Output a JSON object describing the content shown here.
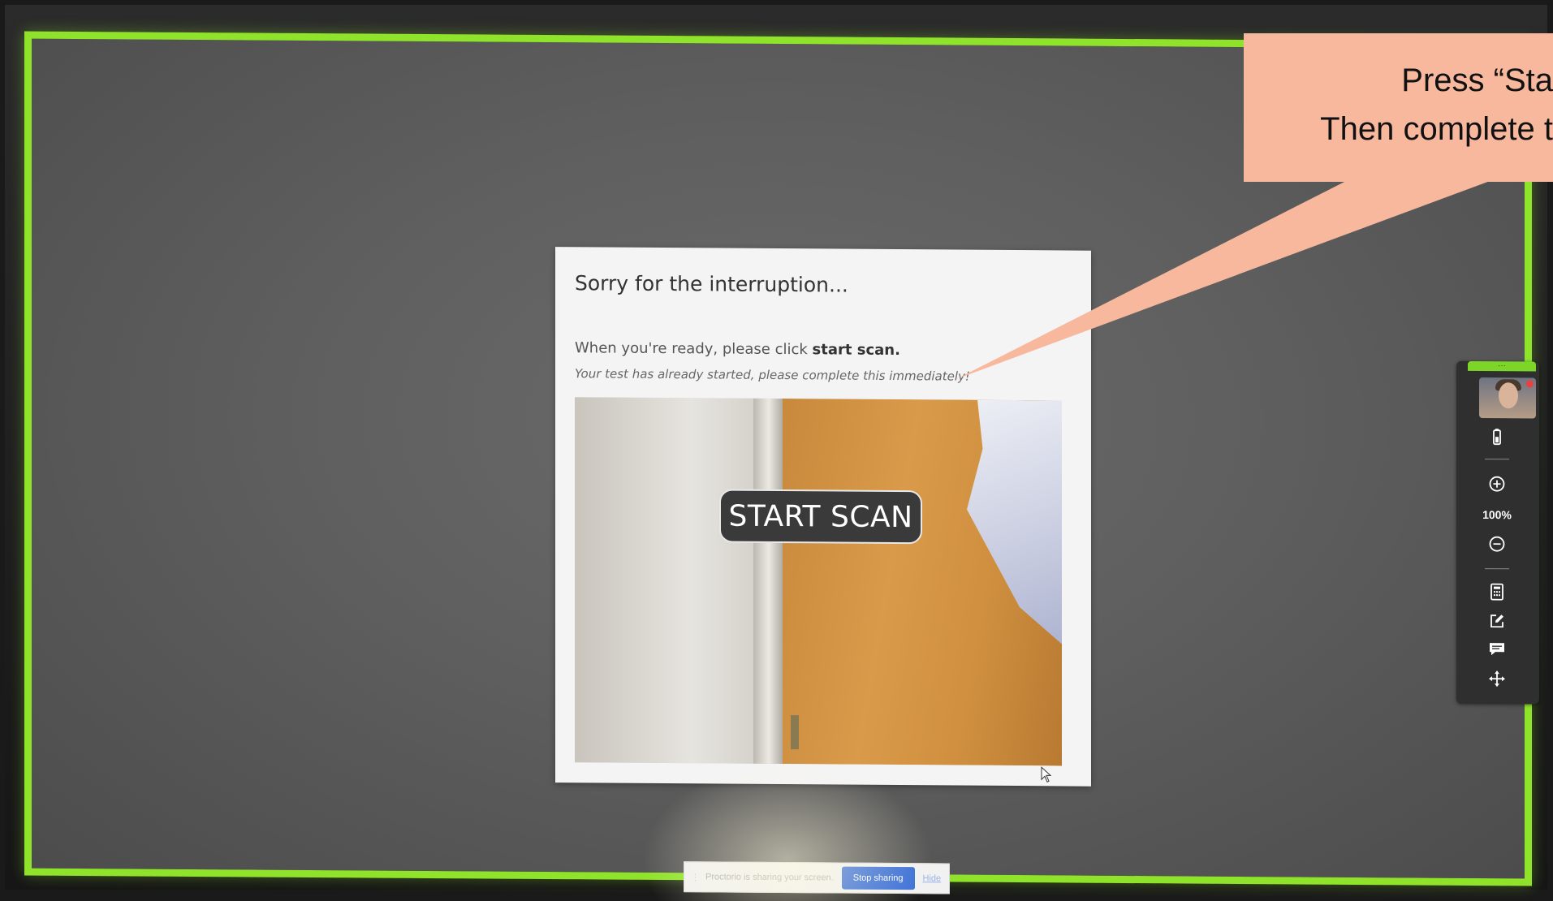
{
  "callout": {
    "line1": "Press “Sta",
    "line2": "Then complete t"
  },
  "dialog": {
    "title": "Sorry for the interruption...",
    "message_prefix": "When you're ready, please click",
    "message_action": "start scan.",
    "note": "Your test has already started, please complete this immediately!",
    "start_scan_label": "START SCAN"
  },
  "toolbar": {
    "zoom_level": "100%",
    "icons": [
      "battery-icon",
      "zoom-in-icon",
      "zoom-out-icon",
      "calculator-icon",
      "notepad-icon",
      "chat-icon",
      "move-icon"
    ]
  },
  "share_bar": {
    "text": "Proctorio is sharing your screen.",
    "stop_label": "Stop sharing",
    "hide_label": "Hide"
  },
  "colors": {
    "highlight_border": "#8fe32a",
    "callout_bg": "#f8b89e",
    "stop_button": "#3a6fd8"
  }
}
